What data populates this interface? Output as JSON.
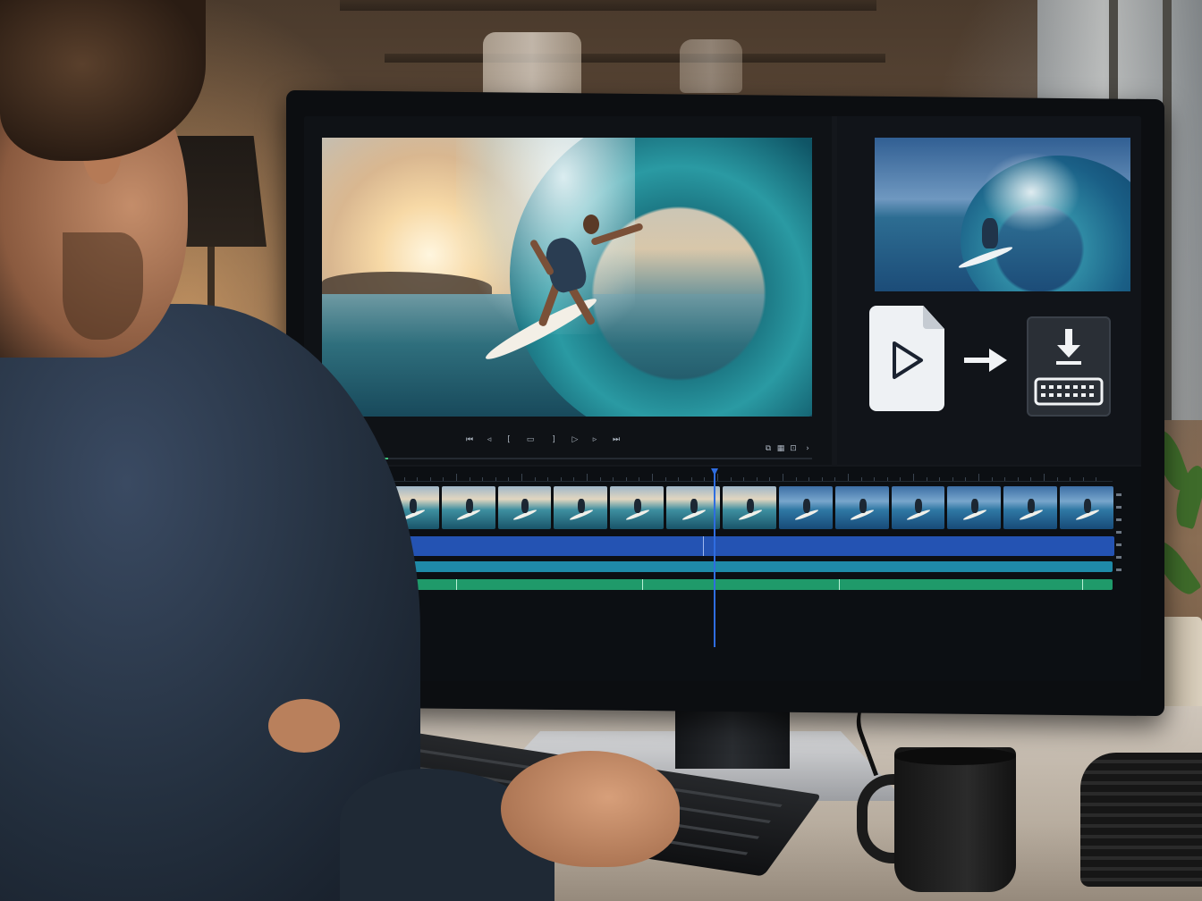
{
  "scene": {
    "description_colors": {
      "accent": "#2f6de0",
      "video_track": "#2453b3",
      "audio_track_1": "#1f8aa8",
      "audio_track_2": "#1f9a6a",
      "scrub_fill": "#3ec27a"
    }
  },
  "editor": {
    "preview": {
      "timecode": "",
      "transport_controls": [
        {
          "name": "timeline-view-icon",
          "glyph": "▮▮"
        },
        {
          "name": "zoom-fit-icon",
          "glyph": "⛶"
        },
        {
          "name": "snapshot-icon",
          "glyph": "▣"
        },
        {
          "name": "go-to-start-icon",
          "glyph": "⏮"
        },
        {
          "name": "step-back-icon",
          "glyph": "◃"
        },
        {
          "name": "mark-in-icon",
          "glyph": "["
        },
        {
          "name": "loop-icon",
          "glyph": "▭"
        },
        {
          "name": "mark-out-icon",
          "glyph": "]"
        },
        {
          "name": "play-icon",
          "glyph": "▷"
        },
        {
          "name": "step-forward-icon",
          "glyph": "▹"
        },
        {
          "name": "go-to-end-icon",
          "glyph": "⏭"
        }
      ],
      "right_controls": [
        {
          "name": "safe-margins-icon",
          "glyph": "⧉"
        },
        {
          "name": "grid-icon",
          "glyph": "▦"
        },
        {
          "name": "export-frame-icon",
          "glyph": "⊡"
        },
        {
          "name": "more-icon",
          "glyph": "›"
        }
      ],
      "playhead_progress": 0.06
    },
    "side_panel": {
      "icons": [
        "video-file-icon",
        "arrow-right-icon",
        "download-keyboard-icon"
      ]
    },
    "timeline": {
      "track_icons": [
        "≡",
        "≡",
        "🔒",
        "≡",
        "≡",
        "≡",
        "≡",
        "≡",
        "≡",
        "≡",
        "≡"
      ],
      "filmstrip_frames": 14,
      "playhead_position": 0.5
    }
  }
}
